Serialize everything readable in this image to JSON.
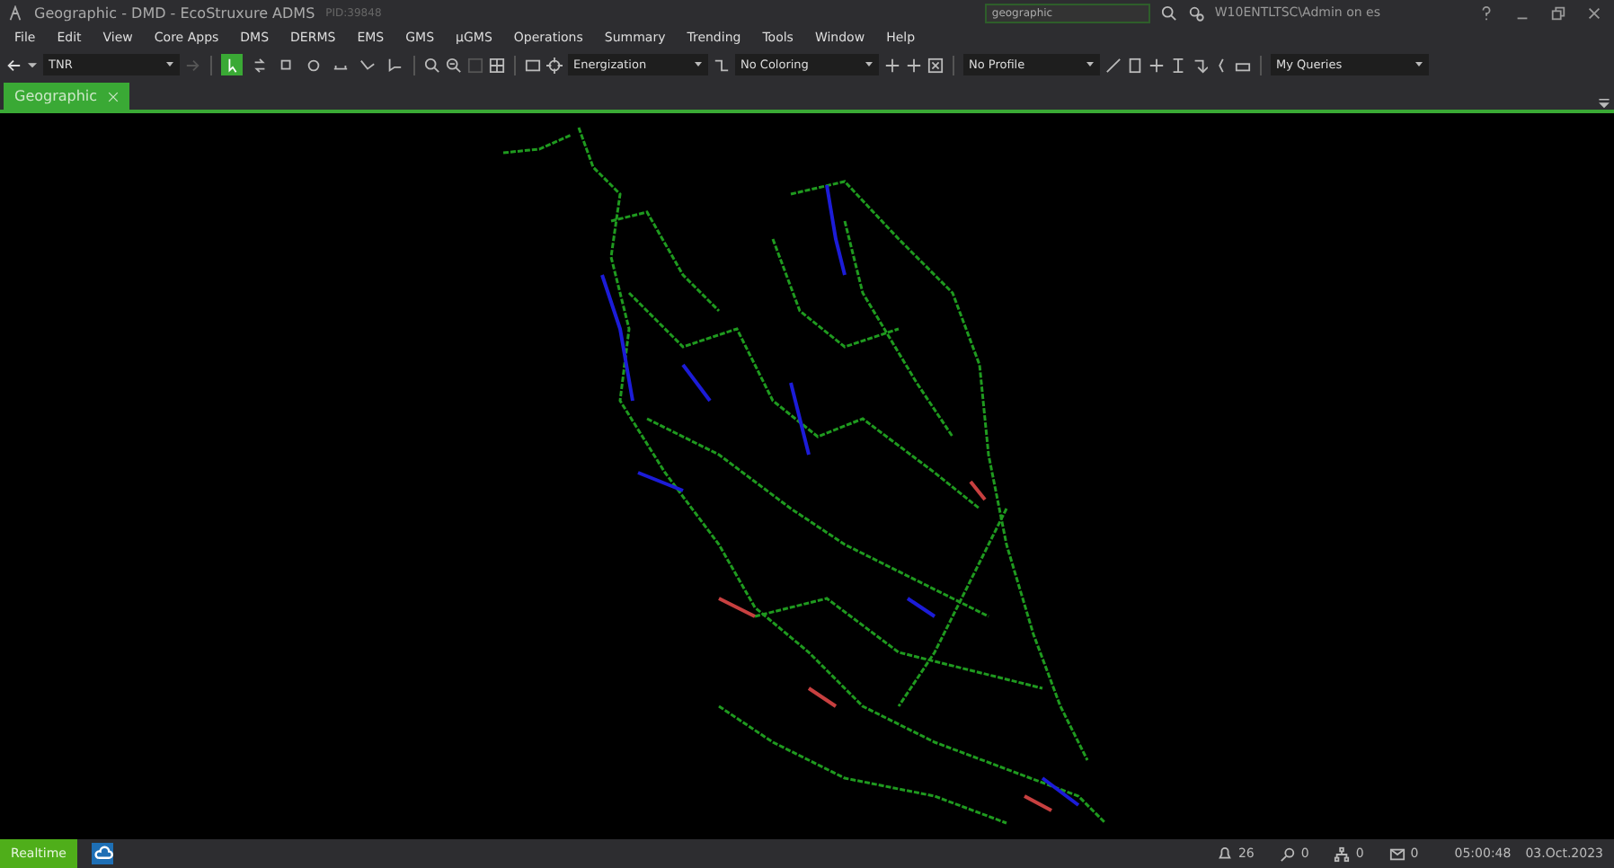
{
  "window": {
    "title": "Geographic - DMD - EcoStruxure ADMS",
    "pid": "PID:39848",
    "search": {
      "value": "geographic"
    },
    "user": "W10ENTLTSC\\Admin on es"
  },
  "menu": [
    "File",
    "Edit",
    "View",
    "Core Apps",
    "DMS",
    "DERMS",
    "EMS",
    "GMS",
    "µGMS",
    "Operations",
    "Summary",
    "Trending",
    "Tools",
    "Window",
    "Help"
  ],
  "toolbar": {
    "combos": [
      "TNR",
      "Energization",
      "No Coloring",
      "No Profile",
      "My Queries"
    ],
    "tools": [
      {
        "selected": true
      },
      {
        "selected": false
      },
      {
        "selected": false
      },
      {
        "selected": false
      },
      {
        "selected": false
      },
      {
        "selected": false
      },
      {
        "selected": false
      }
    ]
  },
  "tabs": [
    {
      "label": "Geographic",
      "selected": true
    }
  ],
  "status_bar": {
    "mode": "Realtime",
    "counters": [
      {
        "kind": "alarms",
        "value": "26"
      },
      {
        "kind": "events",
        "value": "0"
      },
      {
        "kind": "network",
        "value": "0"
      },
      {
        "kind": "messages",
        "value": "0"
      }
    ],
    "time": "05:00:48",
    "date": "03.Oct.2023"
  }
}
